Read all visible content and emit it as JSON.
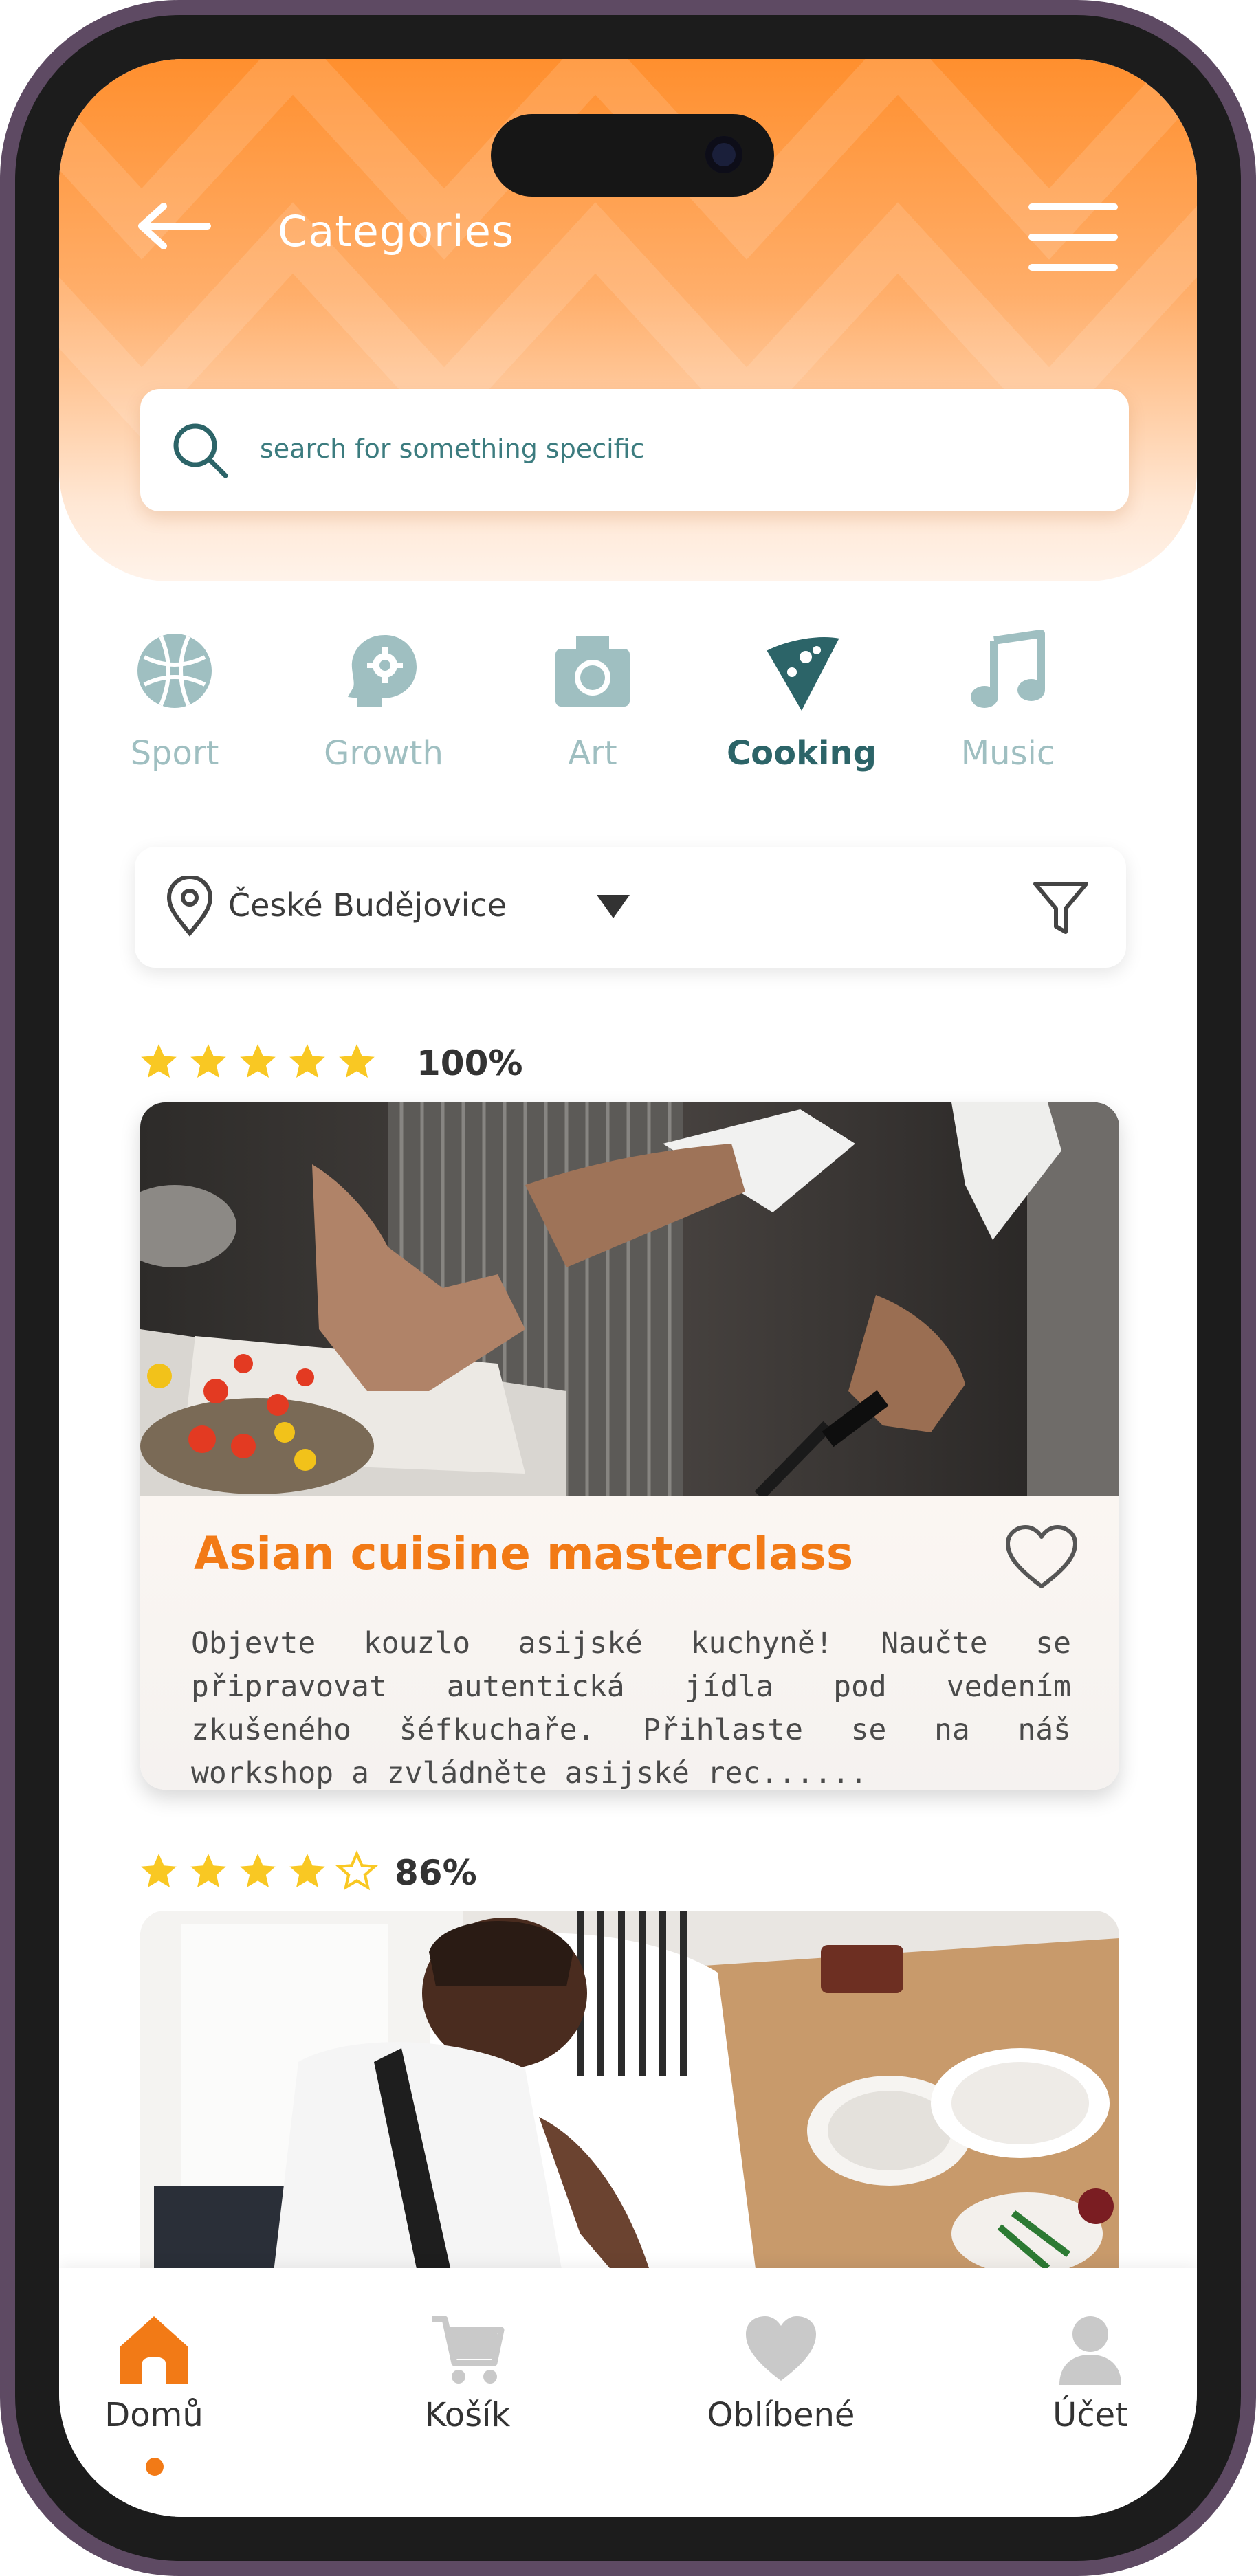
{
  "header": {
    "title": "Categories",
    "search_placeholder": "search for something specific"
  },
  "categories": [
    {
      "label": "Sport",
      "icon": "basketball-icon",
      "active": false
    },
    {
      "label": "Growth",
      "icon": "head-gear-icon",
      "active": false
    },
    {
      "label": "Art",
      "icon": "camera-icon",
      "active": false
    },
    {
      "label": "Cooking",
      "icon": "pizza-slice-icon",
      "active": true
    },
    {
      "label": "Music",
      "icon": "music-note-icon",
      "active": false
    }
  ],
  "location": {
    "city": "České Budějovice"
  },
  "listings": [
    {
      "rating_stars": 5,
      "rating_percent": "100%",
      "title": "Asian cuisine masterclass",
      "description": "Objevte kouzlo asijské kuchyně! Naučte se připravovat autentická jídla pod vedením zkušeného šéfkuchaře. Přihlaste se na náš workshop a zvládněte asijské rec......"
    },
    {
      "rating_stars": 4,
      "rating_percent": "86%"
    }
  ],
  "bottom_nav": [
    {
      "label": "Domů",
      "icon": "home-icon",
      "active": true
    },
    {
      "label": "Košík",
      "icon": "cart-icon",
      "active": false
    },
    {
      "label": "Oblíbené",
      "icon": "heart-icon",
      "active": false
    },
    {
      "label": "Účet",
      "icon": "user-icon",
      "active": false
    }
  ],
  "colors": {
    "accent_orange": "#f27a16",
    "teal_active": "#2c6468",
    "teal_inactive": "#9fbfc1",
    "star_yellow": "#f9c823",
    "nav_inactive": "#c9c9c9"
  }
}
